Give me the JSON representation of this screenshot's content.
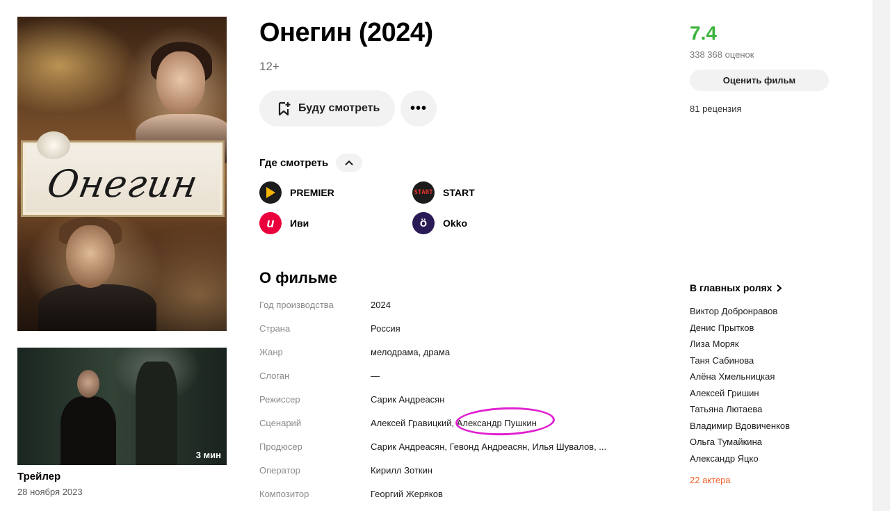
{
  "movie": {
    "title": "Онегин (2024)",
    "age_rating": "12+",
    "poster_title": "Онегин",
    "watch_later_label": "Буду смотреть",
    "more_label": "•••"
  },
  "trailer": {
    "duration": "3 мин",
    "title": "Трейлер",
    "date": "28 ноября 2023"
  },
  "where_to_watch": {
    "label": "Где смотреть",
    "services": [
      {
        "name": "PREMIER",
        "icon": "premier-logo-icon",
        "color": "#1c1c1c"
      },
      {
        "name": "START",
        "icon": "start-logo-icon",
        "color": "#1c1c1c"
      },
      {
        "name": "Иви",
        "icon": "ivi-logo-icon",
        "color": "#ea003d"
      },
      {
        "name": "Okko",
        "icon": "okko-logo-icon",
        "color": "#2a1a55"
      }
    ]
  },
  "about": {
    "heading": "О фильме",
    "rows": [
      {
        "key": "Год производства",
        "value": "2024"
      },
      {
        "key": "Страна",
        "value": "Россия"
      },
      {
        "key": "Жанр",
        "value": "мелодрама, драма"
      },
      {
        "key": "Слоган",
        "value": "—"
      },
      {
        "key": "Режиссер",
        "value": "Сарик Андреасян"
      },
      {
        "key": "Сценарий",
        "value": "Алексей Гравицкий, Александр Пушкин"
      },
      {
        "key": "Продюсер",
        "value": "Сарик Андреасян, Гевонд Андреасян, Илья Шувалов, ..."
      },
      {
        "key": "Оператор",
        "value": "Кирилл Зоткин"
      },
      {
        "key": "Композитор",
        "value": "Георгий Жеряков"
      }
    ]
  },
  "rating": {
    "value": "7.4",
    "count": "338 368 оценок",
    "rate_button": "Оценить фильм",
    "reviews": "81 рецензия",
    "color": "#3bb33b"
  },
  "cast": {
    "heading": "В главных ролях",
    "actors": [
      "Виктор Добронравов",
      "Денис Прытков",
      "Лиза Моряк",
      "Таня Сабинова",
      "Алёна Хмельницкая",
      "Алексей Гришин",
      "Татьяна Лютаева",
      "Владимир Вдовиченков",
      "Ольга Тумайкина",
      "Александр Яцко"
    ],
    "more_link": "22 актера",
    "more_color": "#f0602a"
  },
  "annotation": {
    "color": "#e020d0"
  }
}
